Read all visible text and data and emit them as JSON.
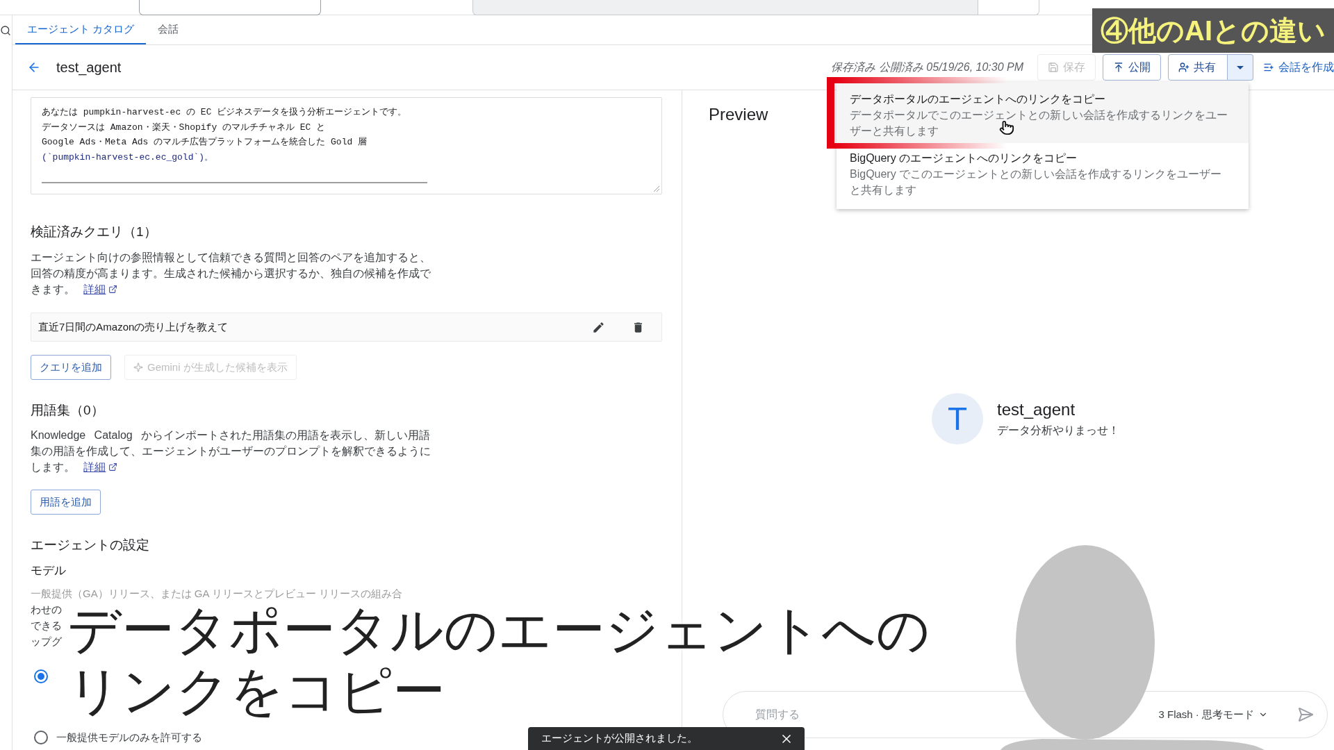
{
  "tabs": [
    {
      "label": "エージェント カタログ",
      "selected": true
    },
    {
      "label": "会話",
      "selected": false
    }
  ],
  "title_bar": {
    "title": "test_agent",
    "status": "保存済み 公開済み 05/19/26, 10:30 PM",
    "buttons": [
      {
        "label": "保存",
        "kind": "save",
        "disabled": true
      },
      {
        "label": "公開",
        "kind": "publish",
        "disabled": false
      },
      {
        "label": "共有",
        "kind": "share",
        "disabled": false
      },
      {
        "label": "会話を作成",
        "kind": "new_chat",
        "disabled": false
      }
    ],
    "share_dropdown": {
      "expanded": true
    }
  },
  "share_menu": {
    "items": [
      {
        "title": "データポータルのエージェントへのリンクをコピー",
        "description": "データポータルでこのエージェントとの新しい会話を作成するリンクをユーザーと共有します",
        "highlighted": true
      },
      {
        "title": "BigQuery のエージェントへのリンクをコピー",
        "description": "BigQuery でこのエージェントとの新しい会話を作成するリンクをユーザーと共有します",
        "highlighted": false
      }
    ]
  },
  "instructions": {
    "lines": [
      {
        "text": "あなたは pumpkin-harvest-ec の EC ビジネスデータを扱う分析エージェントです。",
        "kind": "text"
      },
      {
        "text": "データソースは Amazon・楽天・Shopify のマルチチャネル EC と",
        "kind": "text"
      },
      {
        "text": "Google Ads・Meta Ads のマルチ広告プラットフォームを統合した Gold 層",
        "kind": "text"
      },
      {
        "text": "(`pumpkin-harvest-ec.ec_gold`)。",
        "kind": "code"
      }
    ]
  },
  "verified_queries": {
    "heading": "検証済みクエリ（1）",
    "description": "エージェント向けの参照情報として信頼できる質問と回答のペアを追加すると、回答の精度が高まります。生成された候補から選択するか、独自の候補を作成できます。",
    "link": "詳細",
    "queries": [
      {
        "text": "直近7日間のAmazonの売り上げを教えて"
      }
    ],
    "buttons": [
      {
        "label": "クエリを追加",
        "kind": "add",
        "disabled": false
      },
      {
        "label": "Gemini が生成した候補を表示",
        "kind": "gemini",
        "disabled": true
      }
    ]
  },
  "glossary": {
    "heading": "用語集（0）",
    "description": "Knowledge Catalog からインポートされた用語集の用語を表示し、新しい用語集の用語を作成して、エージェントがユーザーのプロンプトを解釈できるようにします。",
    "link": "詳細",
    "buttons": [
      {
        "label": "用語を追加",
        "kind": "add",
        "disabled": false
      }
    ]
  },
  "agent_settings": {
    "heading": "エージェントの設定",
    "model_label": "モデル",
    "description_first_line": "一般提供（GA）リリース、または GA リリースとプレビュー リリースの組み合",
    "description_fragments": [
      "わせの",
      "できる",
      "ップグ"
    ],
    "options": [
      {
        "selected": true
      },
      {
        "label": "一般提供モデルのみを許可する",
        "selected": false
      }
    ]
  },
  "preview": {
    "title": "Preview",
    "agent": {
      "initial": "T",
      "name": "test_agent",
      "tagline": "データ分析やりまっせ！"
    },
    "input": {
      "placeholder": "質問する",
      "model": "3 Flash · 思考モード"
    }
  },
  "toast": {
    "message": "エージェントが公開されました。"
  },
  "overlay": {
    "badge": "④他のAIとの違い",
    "subtitle_lines": [
      "データポータルのエージェントへの",
      "リンクをコピー"
    ]
  }
}
